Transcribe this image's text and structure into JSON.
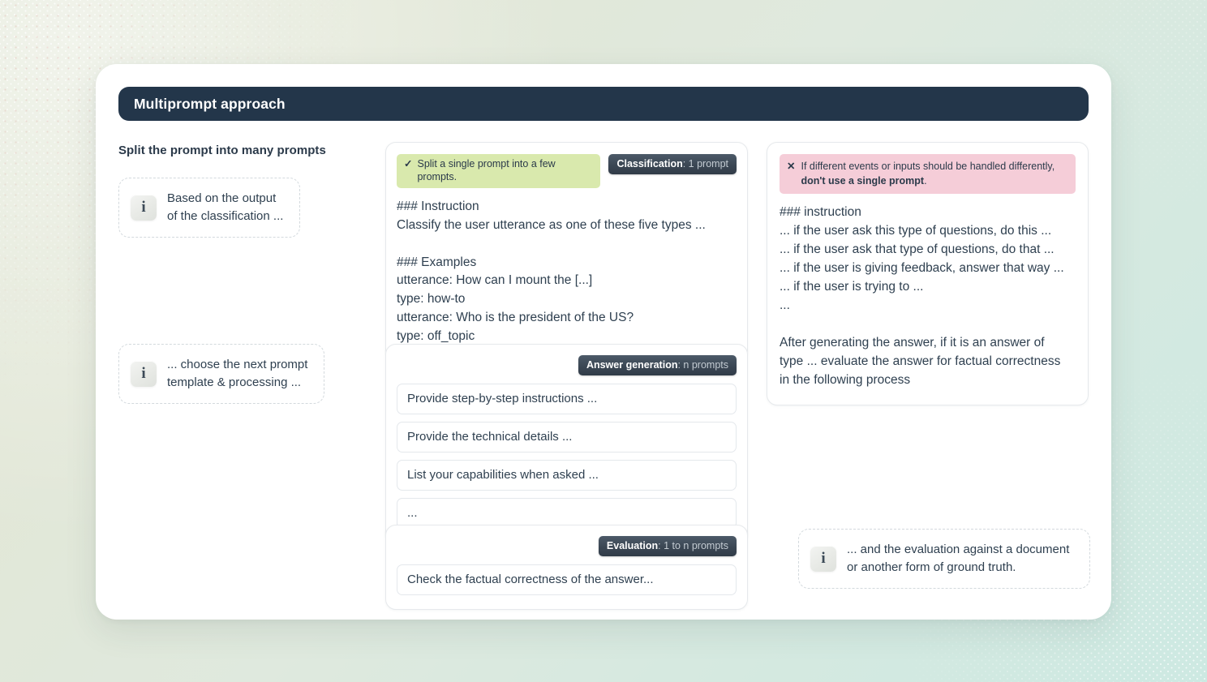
{
  "header": {
    "title": "Multiprompt approach"
  },
  "left_column": {
    "section_title": "Split the prompt into many prompts"
  },
  "notes": [
    {
      "name": "note-classification",
      "icon": "info-icon",
      "icon_glyph": "i",
      "text": "Based on the output\nof the classification ..."
    },
    {
      "name": "note-template",
      "icon": "info-icon",
      "icon_glyph": "i",
      "text": "... choose the next prompt\ntemplate & processing ..."
    },
    {
      "name": "note-evaluation",
      "icon": "info-icon",
      "icon_glyph": "i",
      "text": "... and the evaluation against a document\nor another form of ground truth."
    }
  ],
  "cards": {
    "classification": {
      "good_badge": {
        "mark": "✓",
        "text": "Split a single prompt into a few prompts."
      },
      "stage_badge": {
        "key": "Classification",
        "value": ": 1 prompt"
      },
      "body": "### Instruction\nClassify the user utterance as one of these five types ...\n\n### Examples\nutterance: How can I mount the [...]\ntype: how-to\nutterance: Who is the president of the US?\ntype: off_topic"
    },
    "answer_generation": {
      "stage_badge": {
        "key": "Answer generation",
        "value": ": n prompts"
      },
      "prompts": [
        "Provide step-by-step instructions ...",
        "Provide the technical details ...",
        "List your capabilities when asked ...",
        "..."
      ]
    },
    "evaluation": {
      "stage_badge": {
        "key": "Evaluation",
        "value": ": 1 to n prompts"
      },
      "prompts": [
        "Check the factual correctness of the answer..."
      ]
    },
    "single_prompt": {
      "bad_badge": {
        "mark": "✕",
        "text_before": "If different events or inputs should be handled differently, ",
        "text_bold": "don't use a single prompt",
        "text_after": "."
      },
      "body": "### instruction\n... if the user ask this type of questions, do this ...\n... if the user ask that type of questions, do that ...\n... if the user is giving feedback, answer that way ...\n... if the user is trying to ...\n...\n\nAfter generating the answer, if it is an answer of\ntype ... evaluate the answer for factual correctness\nin the following process"
    }
  },
  "colors": {
    "header_bg": "#23364a",
    "good_badge_bg": "#d9e9ad",
    "bad_badge_bg": "#f5cdd8",
    "stage_badge_bg": "#3b4754",
    "text": "#2f4050",
    "card_border": "#e6e9ec",
    "connector": "#b9c4c2"
  }
}
